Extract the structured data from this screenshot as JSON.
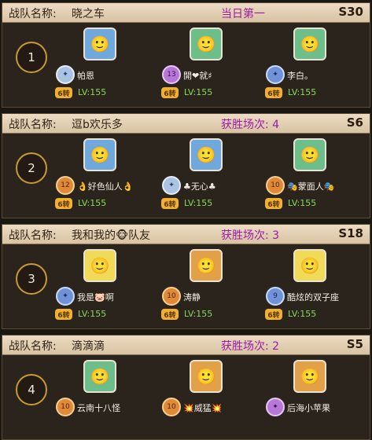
{
  "team_label": "战队名称:",
  "teams": [
    {
      "name": "晓之车",
      "status": "当日第一",
      "server": "S30",
      "rank": "1",
      "members": [
        {
          "name": "帕恩",
          "level": "LV:155",
          "coin": "6转",
          "rank_icon": "silver-rank-badge",
          "rank_num": "",
          "avatar": "blue"
        },
        {
          "name": "開❤就♯",
          "level": "LV:155",
          "coin": "6转",
          "rank_icon": "purple-rank-badge",
          "rank_num": "13",
          "avatar": "green"
        },
        {
          "name": "李白。",
          "level": "LV:155",
          "coin": "6转",
          "rank_icon": "blue-rank-badge",
          "rank_num": "",
          "avatar": "green"
        }
      ]
    },
    {
      "name": "逗b欢乐多",
      "status": "获胜场次: 4",
      "server": "S6",
      "rank": "2",
      "members": [
        {
          "name": "👌好色仙人👌",
          "level": "LV:155",
          "coin": "6转",
          "rank_icon": "orange-rank-badge",
          "rank_num": "12",
          "avatar": "blue"
        },
        {
          "name": "♣无心♣",
          "level": "LV:155",
          "coin": "6转",
          "rank_icon": "silver-rank-badge",
          "rank_num": "",
          "avatar": "blue"
        },
        {
          "name": "🎭蒙面人🎭",
          "level": "LV:155",
          "coin": "6转",
          "rank_icon": "orange-rank-badge",
          "rank_num": "10",
          "avatar": "green"
        }
      ]
    },
    {
      "name": "我和我的🐵队友",
      "status": "获胜场次: 3",
      "server": "S18",
      "rank": "3",
      "members": [
        {
          "name": "我是🐷啊",
          "level": "LV:155",
          "coin": "6转",
          "rank_icon": "blue-rank-badge",
          "rank_num": "",
          "avatar": "yellow"
        },
        {
          "name": "涛静",
          "level": "LV:155",
          "coin": "6转",
          "rank_icon": "orange-rank-badge",
          "rank_num": "10",
          "avatar": "orange"
        },
        {
          "name": "酷炫的双子座",
          "level": "LV:155",
          "coin": "6转",
          "rank_icon": "blue-rank-badge",
          "rank_num": "9",
          "avatar": "yellow"
        }
      ]
    },
    {
      "name": "滴滴滴",
      "status": "获胜场次: 2",
      "server": "S5",
      "rank": "4",
      "members": [
        {
          "name": "云南十八怪",
          "level": "",
          "coin": "",
          "rank_icon": "orange-rank-badge",
          "rank_num": "10",
          "avatar": "green"
        },
        {
          "name": "💥威猛💥",
          "level": "",
          "coin": "",
          "rank_icon": "orange-rank-badge",
          "rank_num": "10",
          "avatar": "orange"
        },
        {
          "name": "后海小苹果",
          "level": "",
          "coin": "",
          "rank_icon": "purple-rank-badge",
          "rank_num": "",
          "avatar": "orange"
        }
      ]
    }
  ]
}
